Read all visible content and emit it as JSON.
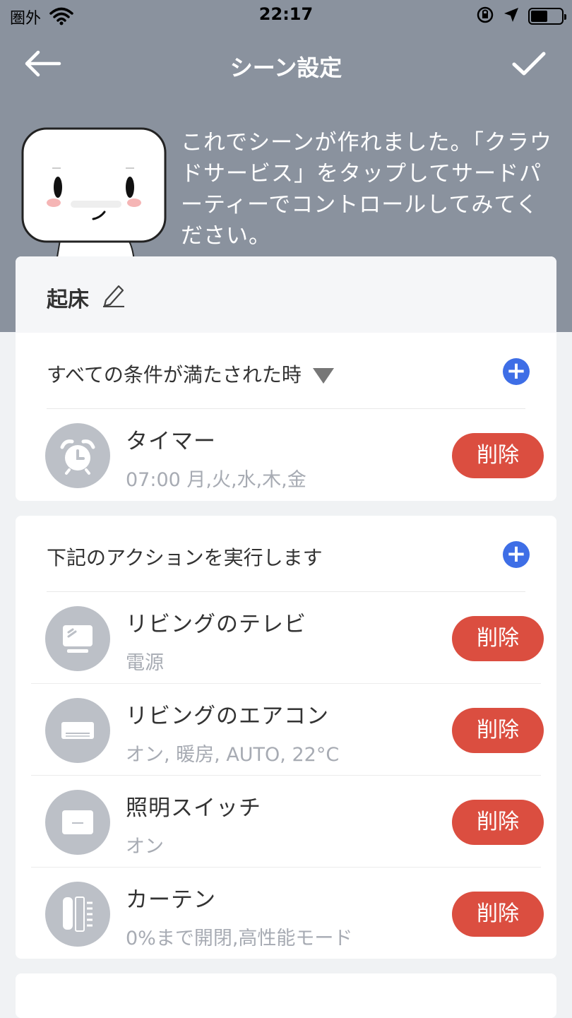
{
  "status_bar": {
    "carrier": "圏外",
    "time": "22:17"
  },
  "nav": {
    "title": "シーン設定"
  },
  "intro_text": "これでシーンが作れました。「クラウドサービス」をタップしてサードパーティーでコントロールしてみてください。",
  "scene": {
    "name": "起床"
  },
  "conditions": {
    "label": "すべての条件が満たされた時",
    "items": [
      {
        "title": "タイマー",
        "subtitle": "07:00 月,火,水,木,金",
        "icon": "alarm-clock-icon",
        "delete_label": "削除"
      }
    ]
  },
  "actions": {
    "label": "下記のアクションを実行します",
    "items": [
      {
        "title": "リビングのテレビ",
        "subtitle": "電源",
        "icon": "tv-icon",
        "delete_label": "削除"
      },
      {
        "title": "リビングのエアコン",
        "subtitle": "オン, 暖房, AUTO, 22°C",
        "icon": "air-conditioner-icon",
        "delete_label": "削除"
      },
      {
        "title": "照明スイッチ",
        "subtitle": "オン",
        "icon": "light-switch-icon",
        "delete_label": "削除"
      },
      {
        "title": "カーテン",
        "subtitle": "0%まで開閉,高性能モード",
        "icon": "curtain-icon",
        "delete_label": "削除"
      }
    ]
  },
  "colors": {
    "header_bg": "#8a929e",
    "accent": "#3e6ee6",
    "delete": "#db4e40",
    "icon_bg": "#bcc0c7"
  }
}
